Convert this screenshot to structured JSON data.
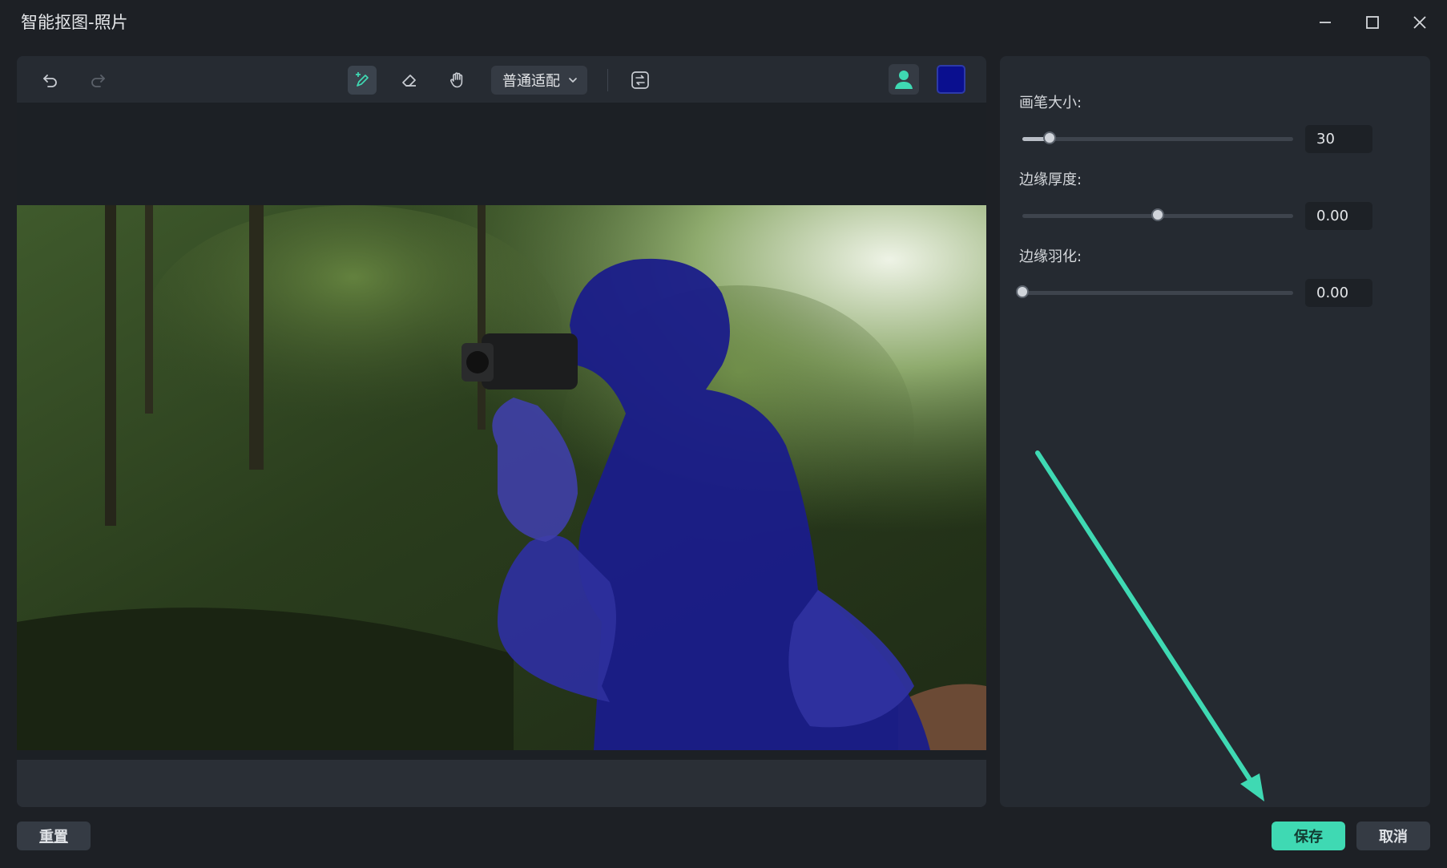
{
  "window": {
    "title": "智能抠图-照片",
    "controls": [
      "minimize-icon",
      "maximize-icon",
      "close-icon"
    ]
  },
  "toolbar": {
    "undo_icon": "undo-icon",
    "redo_icon": "redo-icon",
    "brush_icon": "brush-add-icon",
    "eraser_icon": "eraser-icon",
    "hand_icon": "hand-icon",
    "fit_mode": "普通适配",
    "swap_icon": "swap-icon",
    "avatar_icon": "person-icon",
    "mask_color": "#0a0f8f"
  },
  "settings": {
    "brush_size": {
      "label": "画笔大小:",
      "value": "30",
      "level": 0.1
    },
    "edge_thickness": {
      "label": "边缘厚度:",
      "value": "0.00",
      "level": 0.5
    },
    "edge_feather": {
      "label": "边缘羽化:",
      "value": "0.00",
      "level": 0.0
    }
  },
  "footer": {
    "reset_label": "重置",
    "save_label": "保存",
    "cancel_label": "取消"
  },
  "colors": {
    "accent": "#3fd9b3",
    "background": "#1d2025",
    "panel": "#252a31"
  }
}
